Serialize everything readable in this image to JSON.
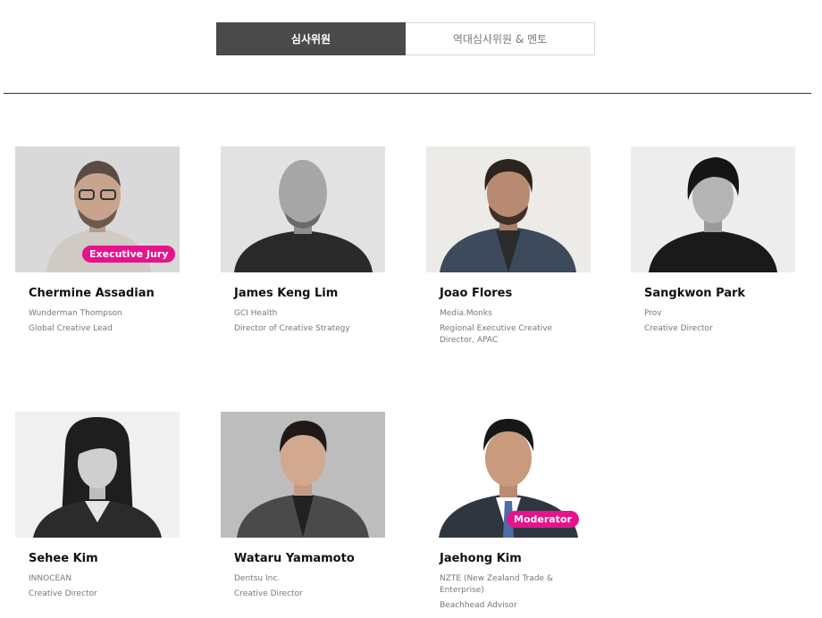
{
  "tabs": [
    {
      "label": "심사위원",
      "active": true
    },
    {
      "label": "역대심사위원 & 멘토",
      "active": false
    }
  ],
  "colors": {
    "accent": "#e6138c",
    "tab_active": "#4a4a4a"
  },
  "jurors": [
    {
      "name": "Chermine Assadian",
      "company": "Wunderman Thompson",
      "title": "Global Creative Lead",
      "badge": "Executive Jury"
    },
    {
      "name": "James Keng Lim",
      "company": "GCI Health",
      "title": "Director of Creative Strategy"
    },
    {
      "name": "Joao Flores",
      "company": "Media.Monks",
      "title": "Regional Executive Creative Director, APAC"
    },
    {
      "name": "Sangkwon Park",
      "company": "Prov",
      "title": "Creative Director"
    },
    {
      "name": "Sehee Kim",
      "company": "INNOCEAN",
      "title": "Creative Director"
    },
    {
      "name": "Wataru Yamamoto",
      "company": "Dentsu Inc.",
      "title": "Creative Director"
    },
    {
      "name": "Jaehong Kim",
      "company": "NZTE (New Zealand Trade & Enterprise)",
      "title": "Beachhead Advisor",
      "badge": "Moderator"
    }
  ]
}
